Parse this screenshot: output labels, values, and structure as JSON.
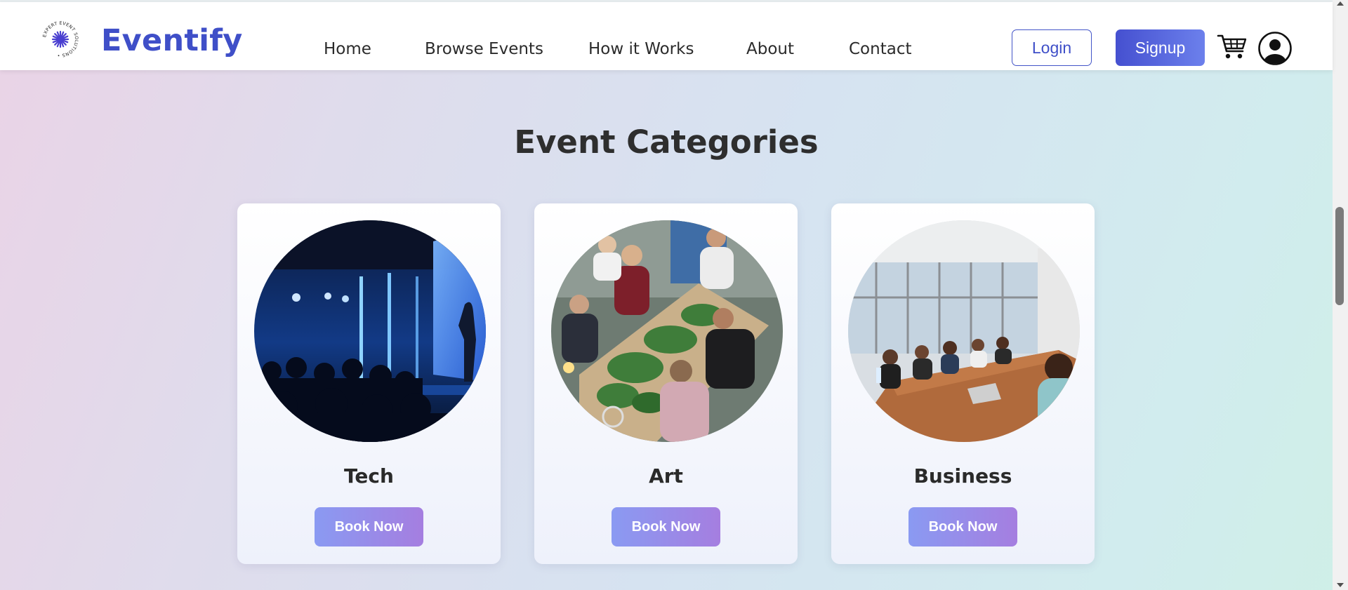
{
  "header": {
    "brand": "Eventify",
    "logo_text": "EXPERT EVENT SOLUTIONS",
    "nav": [
      "Home",
      "Browse Events",
      "How it Works",
      "About",
      "Contact"
    ],
    "login_label": "Login",
    "signup_label": "Signup"
  },
  "main": {
    "section_title": "Event Categories",
    "categories": [
      {
        "name": "Tech",
        "button": "Book Now"
      },
      {
        "name": "Art",
        "button": "Book Now"
      },
      {
        "name": "Business",
        "button": "Book Now"
      }
    ]
  },
  "colors": {
    "brand": "#3f4fc8",
    "signup_gradient_start": "#4550d0",
    "book_gradient_start": "#8a9af2",
    "book_gradient_end": "#a57ee0"
  },
  "icons": {
    "cart": "cart-icon",
    "user": "user-icon"
  }
}
